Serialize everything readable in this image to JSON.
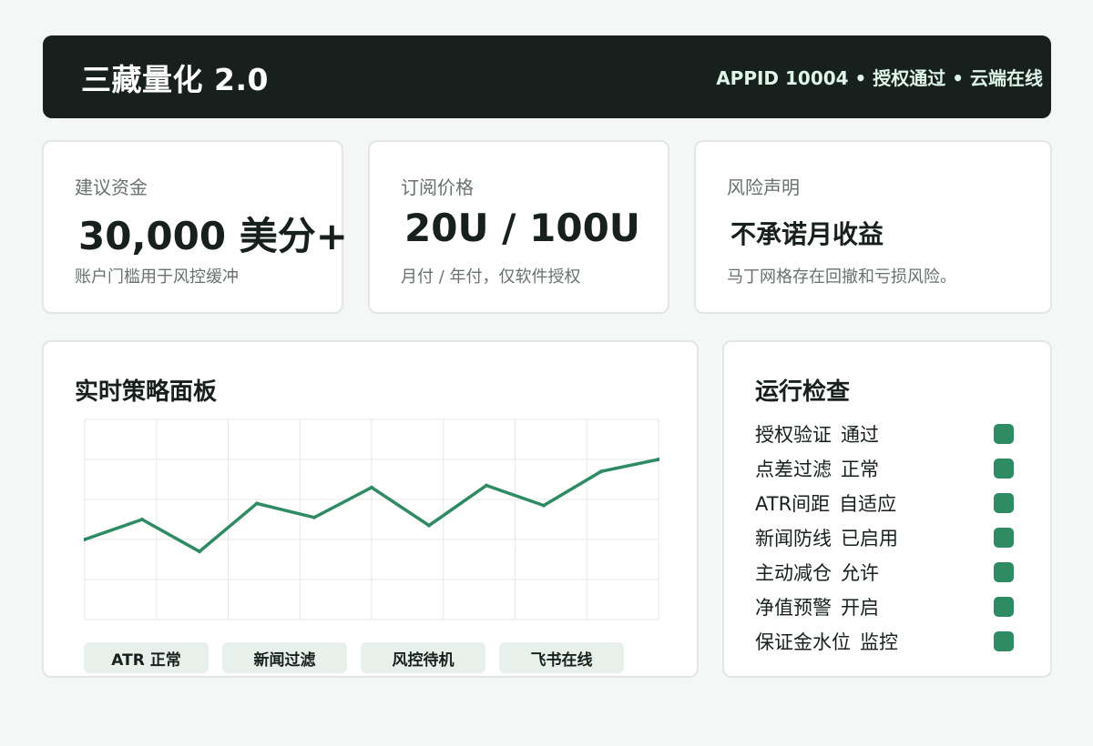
{
  "header": {
    "title": "三藏量化 2.0",
    "status": "APPID 10004 • 授权通过 • 云端在线"
  },
  "metrics": [
    {
      "label": "建议资金",
      "value": "30,000 美分+",
      "note": "账户门槛用于风控缓冲"
    },
    {
      "label": "订阅价格",
      "value": "20U / 100U",
      "note": "月付 / 年付，仅软件授权"
    },
    {
      "label": "风险声明",
      "value": "不承诺月收益",
      "note": "马丁网格存在回撤和亏损风险。"
    }
  ],
  "strategy_panel": {
    "title": "实时策略面板",
    "tags": [
      "ATR 正常",
      "新闻过滤",
      "风控待机",
      "飞书在线"
    ],
    "line_color": "#2e8b63",
    "chart_data": {
      "type": "line",
      "x": [
        0,
        1,
        2,
        3,
        4,
        5,
        6,
        7,
        8,
        9,
        10
      ],
      "values": [
        20,
        25,
        17,
        29,
        25.5,
        33,
        23.5,
        33.5,
        28.5,
        37,
        40
      ],
      "ylim": [
        0,
        50
      ],
      "grid": true
    }
  },
  "checks_panel": {
    "title": "运行检查",
    "status_color": "#2e8b63",
    "items": [
      {
        "name": "授权验证",
        "value": "通过"
      },
      {
        "name": "点差过滤",
        "value": "正常"
      },
      {
        "name": "ATR间距",
        "value": "自适应"
      },
      {
        "name": "新闻防线",
        "value": "已启用"
      },
      {
        "name": "主动减仓",
        "value": "允许"
      },
      {
        "name": "净值预警",
        "value": "开启"
      },
      {
        "name": "保证金水位",
        "value": "监控"
      }
    ]
  }
}
